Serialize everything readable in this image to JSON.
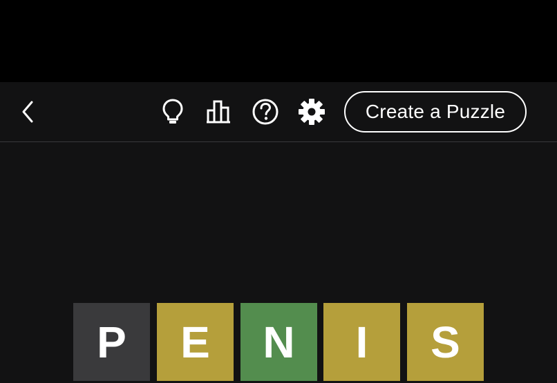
{
  "header": {
    "create_label": "Create a Puzzle",
    "icons": {
      "back": "chevron-left-icon",
      "hint": "lightbulb-icon",
      "stats": "bar-chart-icon",
      "help": "help-circle-icon",
      "settings": "gear-icon"
    }
  },
  "board": {
    "row": [
      {
        "letter": "P",
        "state": "absent",
        "color": "#3a3a3c"
      },
      {
        "letter": "E",
        "state": "present",
        "color": "#b59f3b"
      },
      {
        "letter": "N",
        "state": "correct",
        "color": "#538d4e"
      },
      {
        "letter": "I",
        "state": "present",
        "color": "#b59f3b"
      },
      {
        "letter": "S",
        "state": "present",
        "color": "#b59f3b"
      }
    ]
  },
  "colors": {
    "background": "#121213",
    "top_bar": "#000000",
    "absent": "#3a3a3c",
    "present": "#b59f3b",
    "correct": "#538d4e"
  }
}
